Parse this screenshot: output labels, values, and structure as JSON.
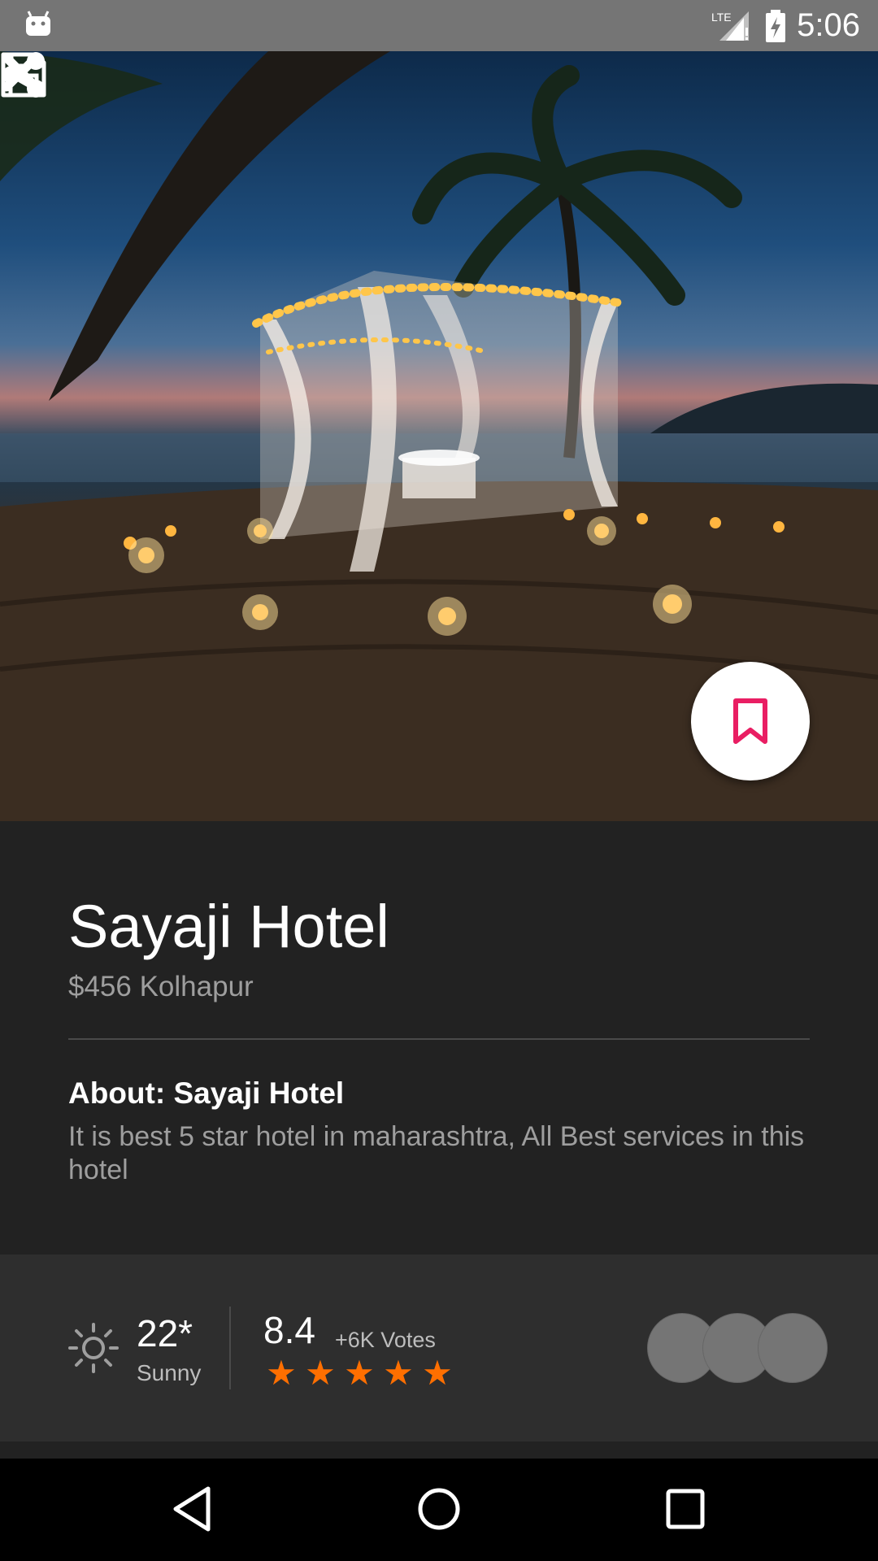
{
  "status_bar": {
    "time": "5:06",
    "network": "LTE",
    "icons": [
      "android-icon",
      "lte-signal-icon",
      "battery-charging-icon"
    ]
  },
  "toolbar": {
    "icons": [
      "close-icon",
      "save-icon",
      "share-icon",
      "more-vert-icon"
    ]
  },
  "fab": {
    "icon": "bookmark-icon",
    "color": "#e91e63"
  },
  "hotel": {
    "name": "Sayaji Hotel",
    "subtitle": "$456 Kolhapur",
    "about_heading": "About: Sayaji Hotel",
    "about_body": "It is best 5 star hotel in maharashtra, All Best services in this hotel"
  },
  "stats": {
    "weather_icon": "sun-icon",
    "temperature": "22*",
    "weather": "Sunny",
    "rating": "8.4",
    "votes": "+6K Votes",
    "stars": 5,
    "star_color": "#ff6f00",
    "avatar_count": 3
  },
  "nav_bar": {
    "icons": [
      "back-icon",
      "home-icon",
      "recents-icon"
    ]
  }
}
